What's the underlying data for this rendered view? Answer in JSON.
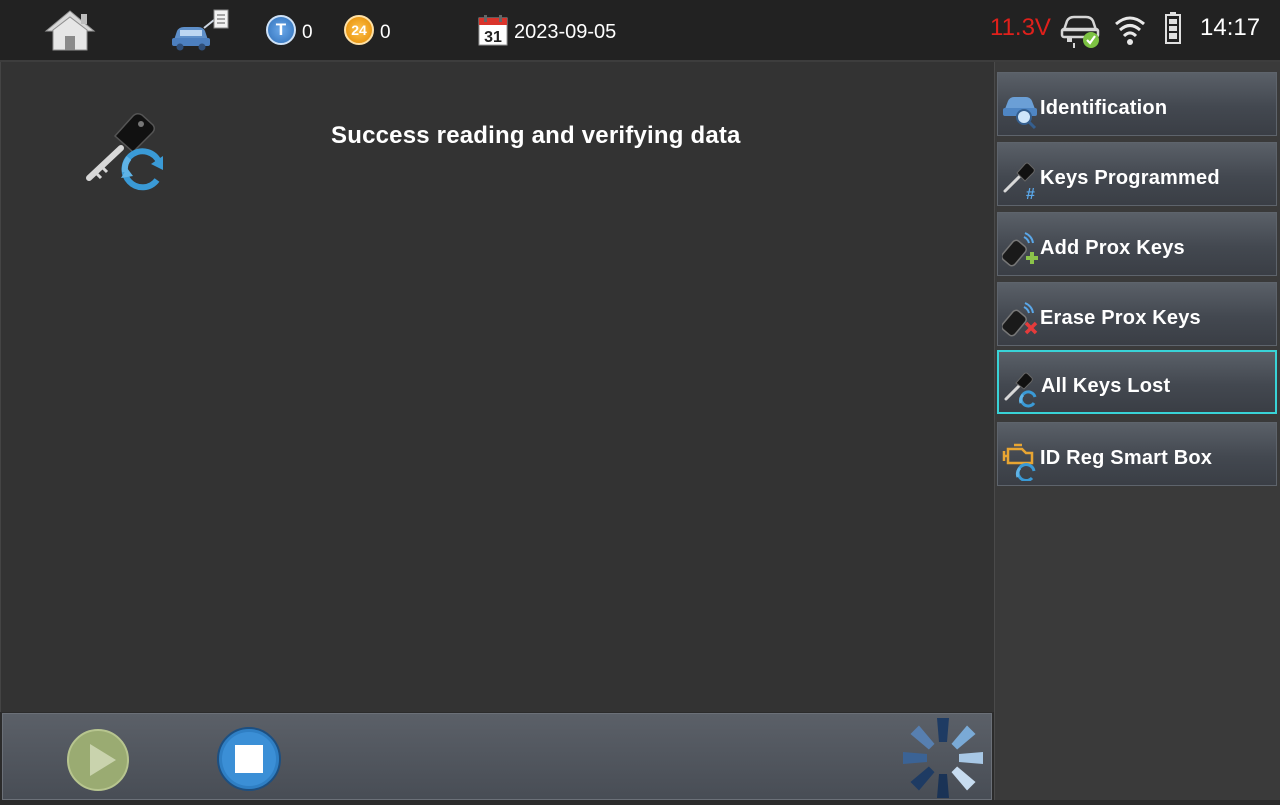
{
  "status_bar": {
    "t_count": "0",
    "c24_count": "0",
    "calendar_day": "31",
    "date": "2023-09-05",
    "voltage": "11.3V",
    "time": "14:17"
  },
  "main": {
    "message": "Success reading and verifying data"
  },
  "sidebar": {
    "items": [
      {
        "label": "Identification",
        "icon": "car-search-icon",
        "selected": false
      },
      {
        "label": "Keys Programmed",
        "icon": "key-hash-icon",
        "selected": false
      },
      {
        "label": "Add Prox Keys",
        "icon": "prox-key-add-icon",
        "selected": false
      },
      {
        "label": "Erase Prox Keys",
        "icon": "prox-key-erase-icon",
        "selected": false
      },
      {
        "label": "All Keys Lost",
        "icon": "key-refresh-icon",
        "selected": true
      },
      {
        "label": "ID Reg Smart Box",
        "icon": "engine-refresh-icon",
        "selected": false
      }
    ]
  },
  "toolbar": {
    "play_icon": "play-icon",
    "stop_icon": "stop-icon",
    "progress_icon": "loading-wheel-icon"
  },
  "colors": {
    "voltage": "#e0201b",
    "selected_border": "#39d3d7",
    "t_badge": "#4a90d9",
    "c24_badge": "#f5a623"
  }
}
